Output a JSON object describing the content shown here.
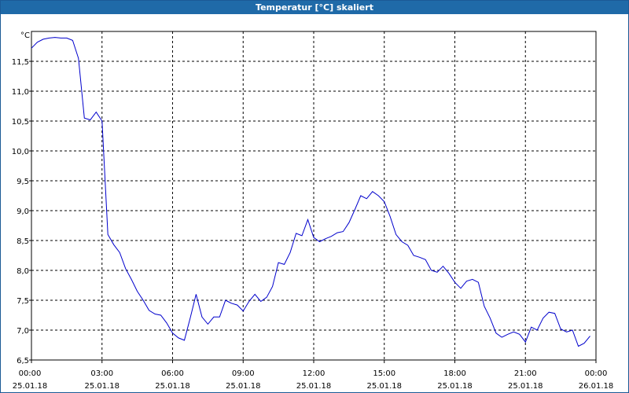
{
  "window": {
    "title": "Temperatur [°C] skaliert"
  },
  "colors": {
    "titlebar": "#1f6aa8",
    "series": "#0000cc",
    "grid": "#000000"
  },
  "chart_data": {
    "type": "line",
    "title": "Temperatur [°C] skaliert",
    "ylabel": "°C",
    "xlabel": "",
    "grid": true,
    "grid_style": "dashed",
    "legend": "none",
    "ylim": [
      6.5,
      12.0
    ],
    "xlim": [
      "25.01.18 00:00",
      "26.01.18 00:00"
    ],
    "y_ticks": [
      "6,5",
      "7,0",
      "7,5",
      "8,0",
      "8,5",
      "9,0",
      "9,5",
      "10,0",
      "10,5",
      "11,0",
      "11,5"
    ],
    "x_ticks": [
      {
        "time": "00:00",
        "date": "25.01.18"
      },
      {
        "time": "03:00",
        "date": "25.01.18"
      },
      {
        "time": "06:00",
        "date": "25.01.18"
      },
      {
        "time": "09:00",
        "date": "25.01.18"
      },
      {
        "time": "12:00",
        "date": "25.01.18"
      },
      {
        "time": "15:00",
        "date": "25.01.18"
      },
      {
        "time": "18:00",
        "date": "25.01.18"
      },
      {
        "time": "21:00",
        "date": "25.01.18"
      },
      {
        "time": "00:00",
        "date": "26.01.18"
      }
    ],
    "series": [
      {
        "x": [
          "25.01.18 00:00",
          "25.01.18 00:15",
          "25.01.18 00:30",
          "25.01.18 00:45",
          "25.01.18 01:00",
          "25.01.18 01:15",
          "25.01.18 01:30",
          "25.01.18 01:45",
          "25.01.18 02:00",
          "25.01.18 02:15",
          "25.01.18 02:30",
          "25.01.18 02:45",
          "25.01.18 03:00",
          "25.01.18 03:15",
          "25.01.18 03:30",
          "25.01.18 03:45",
          "25.01.18 04:00",
          "25.01.18 04:15",
          "25.01.18 04:30",
          "25.01.18 04:45",
          "25.01.18 05:00",
          "25.01.18 05:15",
          "25.01.18 05:30",
          "25.01.18 05:45",
          "25.01.18 06:00",
          "25.01.18 06:15",
          "25.01.18 06:30",
          "25.01.18 06:45",
          "25.01.18 07:00",
          "25.01.18 07:15",
          "25.01.18 07:30",
          "25.01.18 07:45",
          "25.01.18 08:00",
          "25.01.18 08:15",
          "25.01.18 08:30",
          "25.01.18 08:45",
          "25.01.18 09:00",
          "25.01.18 09:15",
          "25.01.18 09:30",
          "25.01.18 09:45",
          "25.01.18 10:00",
          "25.01.18 10:15",
          "25.01.18 10:30",
          "25.01.18 10:45",
          "25.01.18 11:00",
          "25.01.18 11:15",
          "25.01.18 11:30",
          "25.01.18 11:45",
          "25.01.18 12:00",
          "25.01.18 12:15",
          "25.01.18 12:30",
          "25.01.18 12:45",
          "25.01.18 13:00",
          "25.01.18 13:15",
          "25.01.18 13:30",
          "25.01.18 13:45",
          "25.01.18 14:00",
          "25.01.18 14:15",
          "25.01.18 14:30",
          "25.01.18 14:45",
          "25.01.18 15:00",
          "25.01.18 15:15",
          "25.01.18 15:30",
          "25.01.18 15:45",
          "25.01.18 16:00",
          "25.01.18 16:15",
          "25.01.18 16:30",
          "25.01.18 16:45",
          "25.01.18 17:00",
          "25.01.18 17:15",
          "25.01.18 17:30",
          "25.01.18 17:45",
          "25.01.18 18:00",
          "25.01.18 18:15",
          "25.01.18 18:30",
          "25.01.18 18:45",
          "25.01.18 19:00",
          "25.01.18 19:15",
          "25.01.18 19:30",
          "25.01.18 19:45",
          "25.01.18 20:00",
          "25.01.18 20:15",
          "25.01.18 20:30",
          "25.01.18 20:45",
          "25.01.18 21:00",
          "25.01.18 21:15",
          "25.01.18 21:30",
          "25.01.18 21:45",
          "25.01.18 22:00",
          "25.01.18 22:15",
          "25.01.18 22:30",
          "25.01.18 22:45",
          "25.01.18 23:00",
          "25.01.18 23:15",
          "25.01.18 23:30",
          "25.01.18 23:45"
        ],
        "values": [
          11.72,
          11.82,
          11.87,
          11.89,
          11.9,
          11.89,
          11.89,
          11.85,
          11.55,
          10.55,
          10.52,
          10.65,
          10.5,
          8.6,
          8.43,
          8.3,
          8.03,
          7.85,
          7.65,
          7.5,
          7.33,
          7.27,
          7.25,
          7.12,
          6.95,
          6.87,
          6.83,
          7.2,
          7.6,
          7.22,
          7.1,
          7.22,
          7.22,
          7.5,
          7.45,
          7.42,
          7.32,
          7.48,
          7.6,
          7.48,
          7.55,
          7.73,
          8.13,
          8.1,
          8.3,
          8.62,
          8.58,
          8.85,
          8.55,
          8.48,
          8.53,
          8.57,
          8.63,
          8.65,
          8.8,
          9.02,
          9.25,
          9.2,
          9.32,
          9.25,
          9.15,
          8.9,
          8.6,
          8.48,
          8.42,
          8.25,
          8.22,
          8.18,
          8.0,
          7.97,
          8.07,
          7.95,
          7.8,
          7.7,
          7.82,
          7.85,
          7.8,
          7.4,
          7.2,
          6.95,
          6.88,
          6.93,
          6.97,
          6.93,
          6.8,
          7.05,
          7.0,
          7.2,
          7.3,
          7.28,
          7.02,
          6.97,
          7.0,
          6.73,
          6.78,
          6.9
        ]
      }
    ]
  }
}
